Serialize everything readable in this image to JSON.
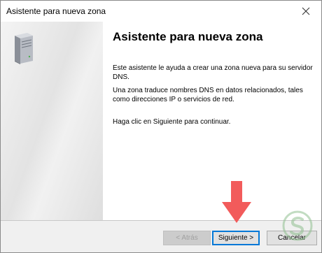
{
  "window": {
    "title": "Asistente para nueva zona"
  },
  "icons": {
    "close": "close-icon",
    "server": "server-icon",
    "arrow": "red-arrow-down-icon",
    "watermark": "solvetic-logo-icon"
  },
  "main": {
    "heading": "Asistente para nueva zona",
    "paragraphs": [
      "Este asistente le ayuda a crear una zona nueva para su servidor DNS.",
      "Una zona traduce nombres DNS en datos relacionados, tales como direcciones IP o servicios de red.",
      "Haga clic en Siguiente para continuar."
    ]
  },
  "buttons": {
    "back_label": "< Atrás",
    "next_label": "Siguiente >",
    "cancel_label": "Cancelar"
  },
  "colors": {
    "focus_border": "#0078d7",
    "arrow": "#f25b5b",
    "watermark": "#8fbf8f"
  }
}
